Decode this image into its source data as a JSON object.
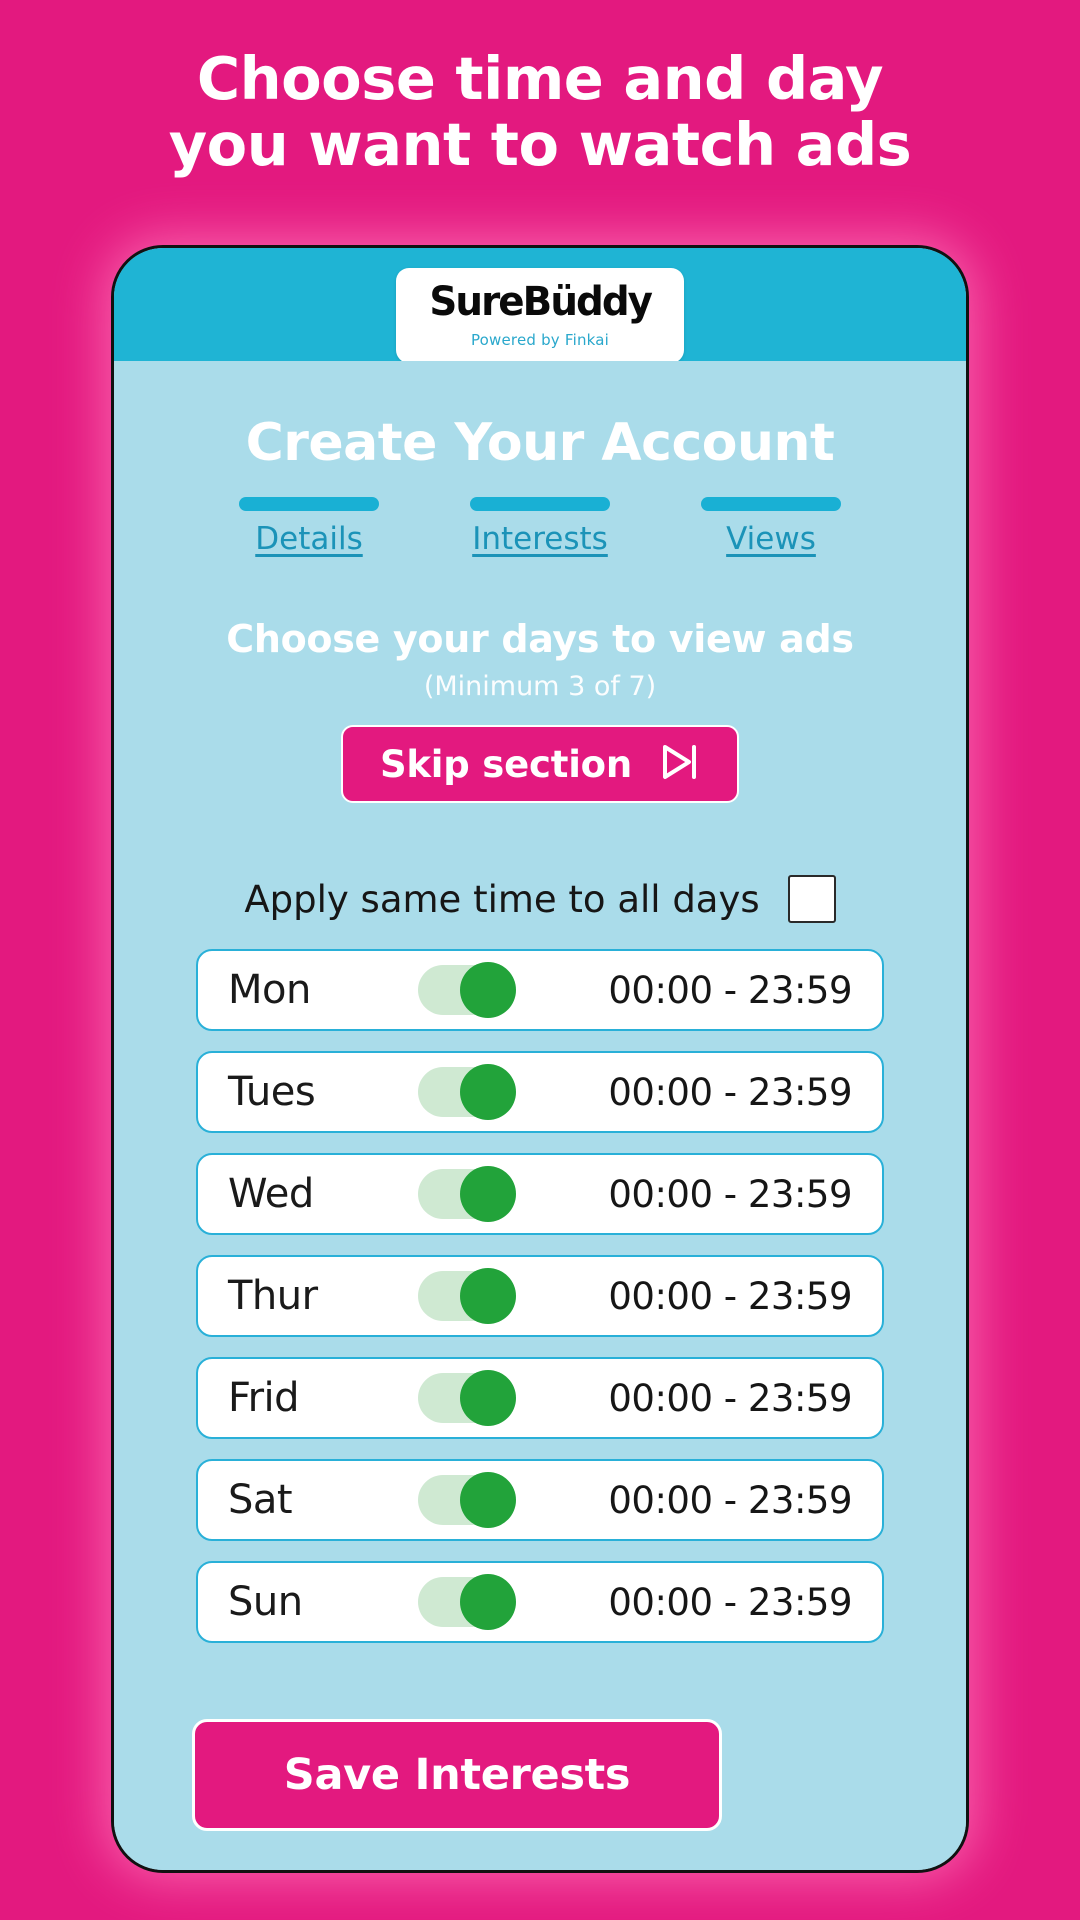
{
  "promo": {
    "line1": "Choose time and day",
    "line2": "you want to watch ads"
  },
  "app": {
    "logo_text": "SureBüddy",
    "logo_tagline": "Powered by Finkai",
    "page_title": "Create Your Account"
  },
  "steps": [
    {
      "label": "Details"
    },
    {
      "label": "Interests"
    },
    {
      "label": "Views"
    }
  ],
  "section": {
    "title": "Choose your days to view ads",
    "subtitle": "(Minimum 3 of 7)",
    "skip_label": "Skip section",
    "skip_icon": "skip-forward-icon"
  },
  "apply_all": {
    "label": "Apply same time to all days",
    "checked": false
  },
  "days": [
    {
      "name": "Mon",
      "enabled": true,
      "time": "00:00 - 23:59"
    },
    {
      "name": "Tues",
      "enabled": true,
      "time": "00:00 - 23:59"
    },
    {
      "name": "Wed",
      "enabled": true,
      "time": "00:00 - 23:59"
    },
    {
      "name": "Thur",
      "enabled": true,
      "time": "00:00 - 23:59"
    },
    {
      "name": "Frid",
      "enabled": true,
      "time": "00:00 - 23:59"
    },
    {
      "name": "Sat",
      "enabled": true,
      "time": "00:00 - 23:59"
    },
    {
      "name": "Sun",
      "enabled": true,
      "time": "00:00 - 23:59"
    }
  ],
  "footer": {
    "save_label": "Save Interests"
  },
  "colors": {
    "brand_pink": "#e3197f",
    "brand_cyan": "#1fb4d4",
    "panel_blue": "#aadcea",
    "toggle_on": "#22a33a",
    "step_link": "#1b93b8"
  }
}
